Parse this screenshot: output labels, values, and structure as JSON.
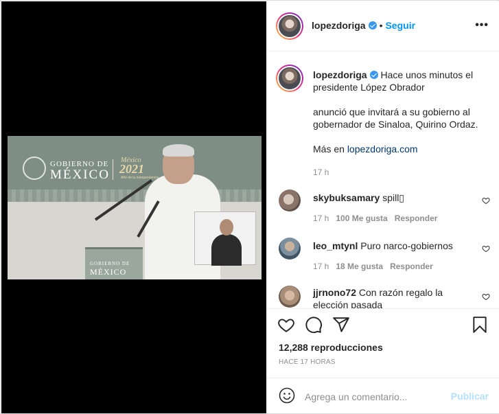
{
  "post": {
    "author": "lopezdoriga",
    "follow_label": "Seguir",
    "dot": "•",
    "more_label": "•••"
  },
  "video": {
    "sign_line1": "GOBIERNO DE",
    "sign_line2": "MÉXICO",
    "sign_year_small": "México",
    "sign_year": "2021",
    "sign_year_sub": "Año de la Independencia",
    "podium_line1": "GOBIERNO DE",
    "podium_line2": "MÉXICO"
  },
  "caption": {
    "username": "lopezdoriga",
    "line1": "Hace unos minutos el presidente López Obrador",
    "line2": "anunció que invitará a su gobierno al gobernador de Sinaloa, Quirino Ordaz.",
    "more_prefix": "Más en ",
    "link": "lopezdoriga.com",
    "time": "17 h"
  },
  "comments": [
    {
      "username": "skybuksamary",
      "text": "spill▯",
      "time": "17 h",
      "likes": "100 Me gusta",
      "reply": "Responder"
    },
    {
      "username": "leo_mtynl",
      "text": "Puro narco-gobiernos",
      "time": "17 h",
      "likes": "18 Me gusta",
      "reply": "Responder"
    },
    {
      "username": "jjrnono72",
      "text": "Con razón regalo la elección pasada"
    }
  ],
  "stats": {
    "views": "12,288 reproducciones",
    "ago": "HACE 17 HORAS"
  },
  "composer": {
    "placeholder": "Agrega un comentario...",
    "publish": "Publicar"
  },
  "colors": {
    "accent": "#0095f6",
    "verified": "#3897f0",
    "publish_disabled": "#b2dffc"
  }
}
